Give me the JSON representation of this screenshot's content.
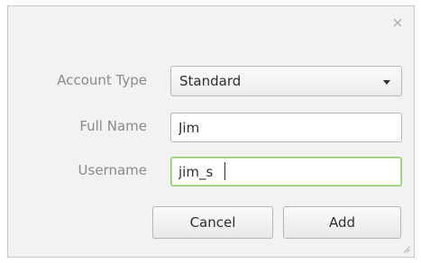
{
  "dialog": {
    "close_glyph": "×",
    "account_type": {
      "label": "Account Type",
      "value": "Standard"
    },
    "full_name": {
      "label": "Full Name",
      "value": "Jim"
    },
    "username": {
      "label": "Username",
      "value": "jim_s"
    },
    "buttons": {
      "cancel": "Cancel",
      "add": "Add"
    }
  },
  "icons": {
    "close": "close-icon",
    "dropdown": "chevron-down-icon",
    "resize": "resize-grip-icon"
  },
  "colors": {
    "focus_border": "#8dc86a",
    "label_text": "#8a8a8a",
    "dialog_bg": "#f2f2f2"
  }
}
